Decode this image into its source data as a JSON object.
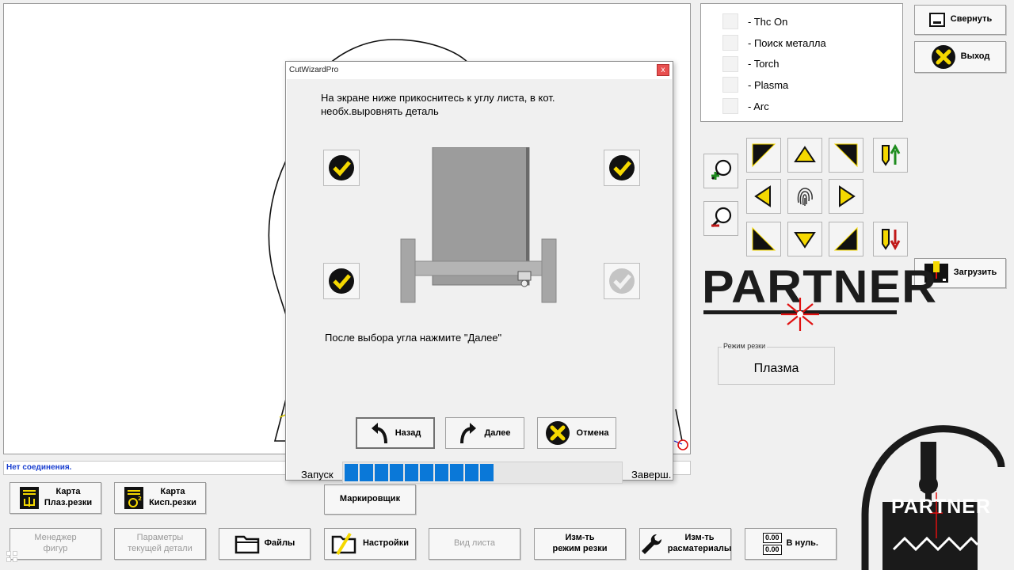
{
  "status": {
    "text": "Нет соединения."
  },
  "checklist": [
    {
      "label": "- Thc On"
    },
    {
      "label": "- Поиск металла"
    },
    {
      "label": "- Torch"
    },
    {
      "label": "- Plasma"
    },
    {
      "label": "- Arc"
    }
  ],
  "top_buttons": {
    "minimize": "Свернуть",
    "exit": "Выход",
    "load": "Загрузить"
  },
  "brand": {
    "text": "PARTNER",
    "logo_text": "PARTNER"
  },
  "cut_mode": {
    "legend": "Режим резки",
    "value": "Плазма"
  },
  "bottom_row1": {
    "plasma_map_l1": "Карта",
    "plasma_map_l2": "Плаз.резки",
    "oxy_map_l1": "Карта",
    "oxy_map_l2": "Кисп.резки",
    "marker": "Маркировщик"
  },
  "bottom_row2": {
    "shape_mgr_l1": "Менеджер",
    "shape_mgr_l2": "фигур",
    "part_params_l1": "Параметры",
    "part_params_l2": "текущей детали",
    "files": "Файлы",
    "settings": "Настройки",
    "sheet_view": "Вид листа",
    "cut_mode_l1": "Изм-ть",
    "cut_mode_l2": "режим резки",
    "consumables_l1": "Изм-ть",
    "consumables_l2": "расматериалы",
    "zero_value": "0.00",
    "zero_label": "В нуль."
  },
  "dialog": {
    "title": "CutWizardPro",
    "close": "x",
    "instruction": "На экране ниже прикоснитесь к углу листа, в кот. необх.выровнять деталь",
    "hint": "После выбора угла нажмите \"Далее\"",
    "back": "Назад",
    "next": "Далее",
    "cancel": "Отмена",
    "progress_start": "Запуск",
    "progress_end": "Заверш.",
    "progress_filled_segments": 10,
    "progress_fraction": 0.54
  },
  "colors": {
    "accent_yellow": "#f5d800",
    "progress_blue": "#0a78d8",
    "status_blue": "#1a3fd0",
    "logo_red": "#e01010",
    "arrow_green": "#1e8c1e",
    "arrow_red": "#c01818"
  }
}
